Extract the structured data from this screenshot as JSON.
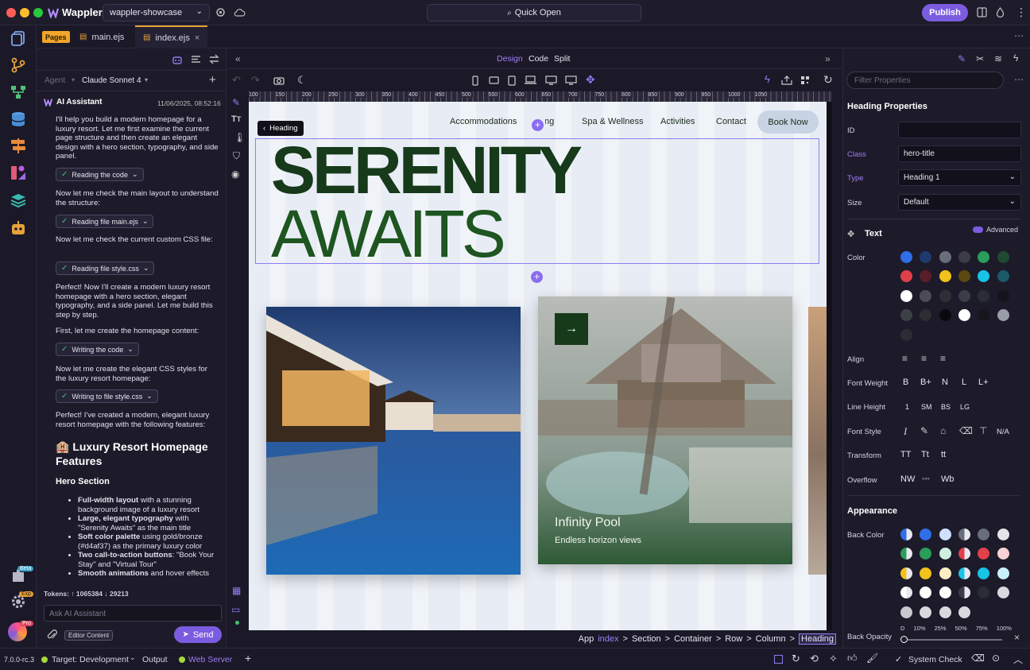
{
  "app": {
    "name": "Wappler",
    "project": "wappler-showcase",
    "quick_open": "Quick Open",
    "publish": "Publish",
    "version": "7.0.0-rc.3"
  },
  "tabs": [
    {
      "label": "main.ejs"
    },
    {
      "label": "index.ejs"
    }
  ],
  "pages_badge": "Pages",
  "view_tabs": [
    "Design",
    "Code",
    "Split"
  ],
  "chat": {
    "agent_label": "Agent",
    "model": "Claude Sonnet 4",
    "assistant_name": "AI Assistant",
    "timestamp": "11/06/2025, 08:52:16",
    "intro": "I'll help you build a modern homepage for a luxury resort. Let me first examine the current page structure and then create an elegant design with a hero section, typography, and side panel.",
    "chip1": "Reading the code",
    "p2": "Now let me check the main layout to understand the structure:",
    "chip2": "Reading file main.ejs",
    "p3": "Now let me check the current custom CSS file:",
    "chip3": "Reading file style.css",
    "p4": "Perfect! Now I'll create a modern luxury resort homepage with a hero section, elegant typography, and a side panel. Let me build this step by step.",
    "p5": "First, let me create the homepage content:",
    "chip4": "Writing the code",
    "p6": "Now let me create the elegant CSS styles for the luxury resort homepage:",
    "chip5": "Writing to file style.css",
    "p7": "Perfect! I've created a modern, elegant luxury resort homepage with the following features:",
    "h_features": "🏨 Luxury Resort Homepage Features",
    "h_hero": "Hero Section",
    "bullets": [
      {
        "b": "Full-width layout",
        "t": " with a stunning background image of a luxury resort"
      },
      {
        "b": "Large, elegant typography",
        "t": " with \"Serenity Awaits\" as the main title"
      },
      {
        "b": "Soft color palette",
        "t": " using gold/bronze (#d4af37) as the primary luxury color"
      },
      {
        "b": "Two call-to-action buttons",
        "t": ": \"Book Your Stay\" and \"Virtual Tour\""
      },
      {
        "b": "Smooth animations",
        "t": " and hover effects"
      }
    ],
    "tokens": "Tokens: ↑ 1065384 ↓ 29213",
    "input_placeholder": "Ask AI Assistant",
    "editor_content": "Editor Content",
    "send": "Send"
  },
  "canvas": {
    "heading_tag": "Heading",
    "nav": [
      "Accommodations",
      "Dining",
      "Spa & Wellness",
      "Activities",
      "Contact"
    ],
    "book_now": "Book Now",
    "title_line1": "SERENITY",
    "title_line2": "AWAITS",
    "card2_title": "Infinity Pool",
    "card2_sub": "Endless horizon views",
    "ruler_ticks": [
      "100",
      "150",
      "200",
      "250",
      "300",
      "350",
      "400",
      "450",
      "500",
      "550",
      "600",
      "650",
      "700",
      "750",
      "800",
      "850",
      "900",
      "950",
      "1000",
      "1050"
    ]
  },
  "breadcrumb": [
    "App",
    "index",
    "Section",
    "Container",
    "Row",
    "Column",
    "Heading"
  ],
  "props": {
    "filter_placeholder": "Filter Properties",
    "heading": "Heading Properties",
    "id_label": "ID",
    "id_value": "",
    "class_label": "Class",
    "class_value": "hero-title",
    "type_label": "Type",
    "type_value": "Heading 1",
    "size_label": "Size",
    "size_value": "Default",
    "text_section": "Text",
    "advanced": "Advanced",
    "color_label": "Color",
    "align_label": "Align",
    "font_weight_label": "Font Weight",
    "font_weights": [
      "B",
      "B+",
      "N",
      "L",
      "L+"
    ],
    "line_height_label": "Line Height",
    "line_heights": [
      "1",
      "SM",
      "BS",
      "LG"
    ],
    "font_style_label": "Font Style",
    "font_style_na": "N/A",
    "transform_label": "Transform",
    "transforms": [
      "TT",
      "Tt",
      "tt"
    ],
    "overflow_label": "Overflow",
    "overflows": [
      "NW",
      "◦◦◦",
      "Wb"
    ],
    "appearance": "Appearance",
    "back_color_label": "Back Color",
    "back_opacity_label": "Back Opacity",
    "opacity_ticks": [
      "D",
      "10%",
      "25%",
      "50%",
      "75%",
      "100%"
    ]
  },
  "status": {
    "target": "Target: Development",
    "output": "Output",
    "web_server": "Web Server",
    "system_check": "System Check"
  },
  "badges": {
    "beta": "Beta",
    "exp": "Exp",
    "pro": "Pro"
  }
}
